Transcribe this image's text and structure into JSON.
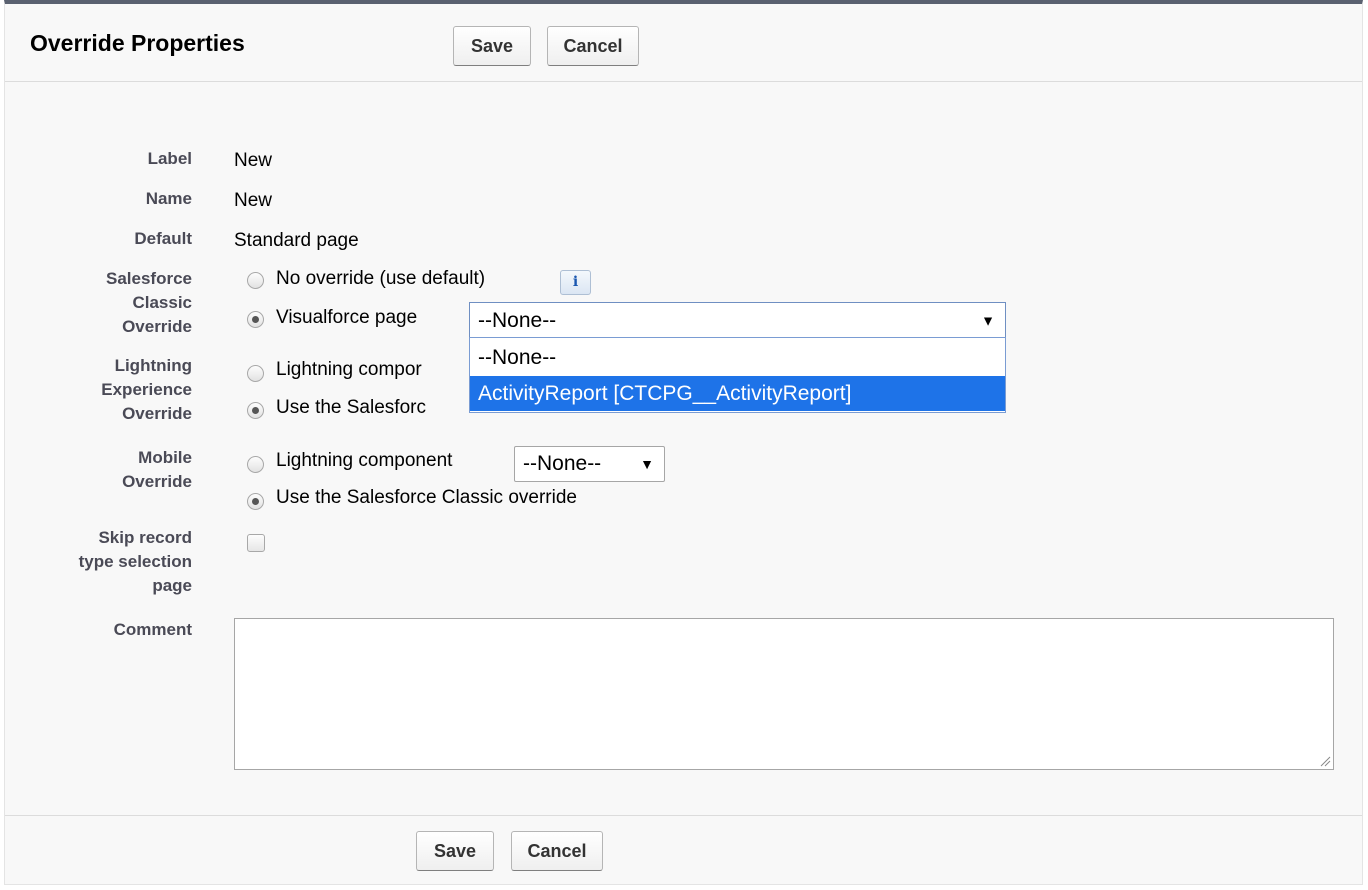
{
  "header": {
    "title": "Override Properties",
    "save_label": "Save",
    "cancel_label": "Cancel"
  },
  "fields": {
    "label": {
      "label": "Label",
      "value": "New"
    },
    "name": {
      "label": "Name",
      "value": "New"
    },
    "default": {
      "label": "Default",
      "value": "Standard page"
    },
    "classic_override": {
      "label_lines": [
        "Salesforce",
        "Classic",
        "Override"
      ],
      "option_no_override": "No override (use default)",
      "option_visualforce": "Visualforce page",
      "selected_option": "Visualforce page",
      "visualforce_select_value": "--None--",
      "visualforce_options": [
        "--None--",
        "ActivityReport [CTCPG__ActivityReport]"
      ],
      "highlighted_option": "ActivityReport [CTCPG__ActivityReport]"
    },
    "lightning_override": {
      "label_lines": [
        "Lightning",
        "Experience",
        "Override"
      ],
      "option_component": "Lightning compor",
      "option_use_classic": "Use the Salesforc",
      "selected_option": "Use the Salesforc"
    },
    "mobile_override": {
      "label_lines": [
        "Mobile",
        "Override"
      ],
      "option_component": "Lightning component",
      "component_select_value": "--None--",
      "option_use_classic": "Use the Salesforce Classic override",
      "selected_option": "Use the Salesforce Classic override"
    },
    "skip_record_type": {
      "label_lines": [
        "Skip record",
        "type selection",
        "page"
      ],
      "checked": false
    },
    "comment": {
      "label": "Comment",
      "value": ""
    }
  },
  "footer": {
    "save_label": "Save",
    "cancel_label": "Cancel"
  },
  "icons": {
    "info": "info-icon",
    "dropdown_arrow": "▼"
  },
  "colors": {
    "highlight": "#1e73e8",
    "header_border": "#5a6170",
    "label_text": "#4a4a56"
  }
}
